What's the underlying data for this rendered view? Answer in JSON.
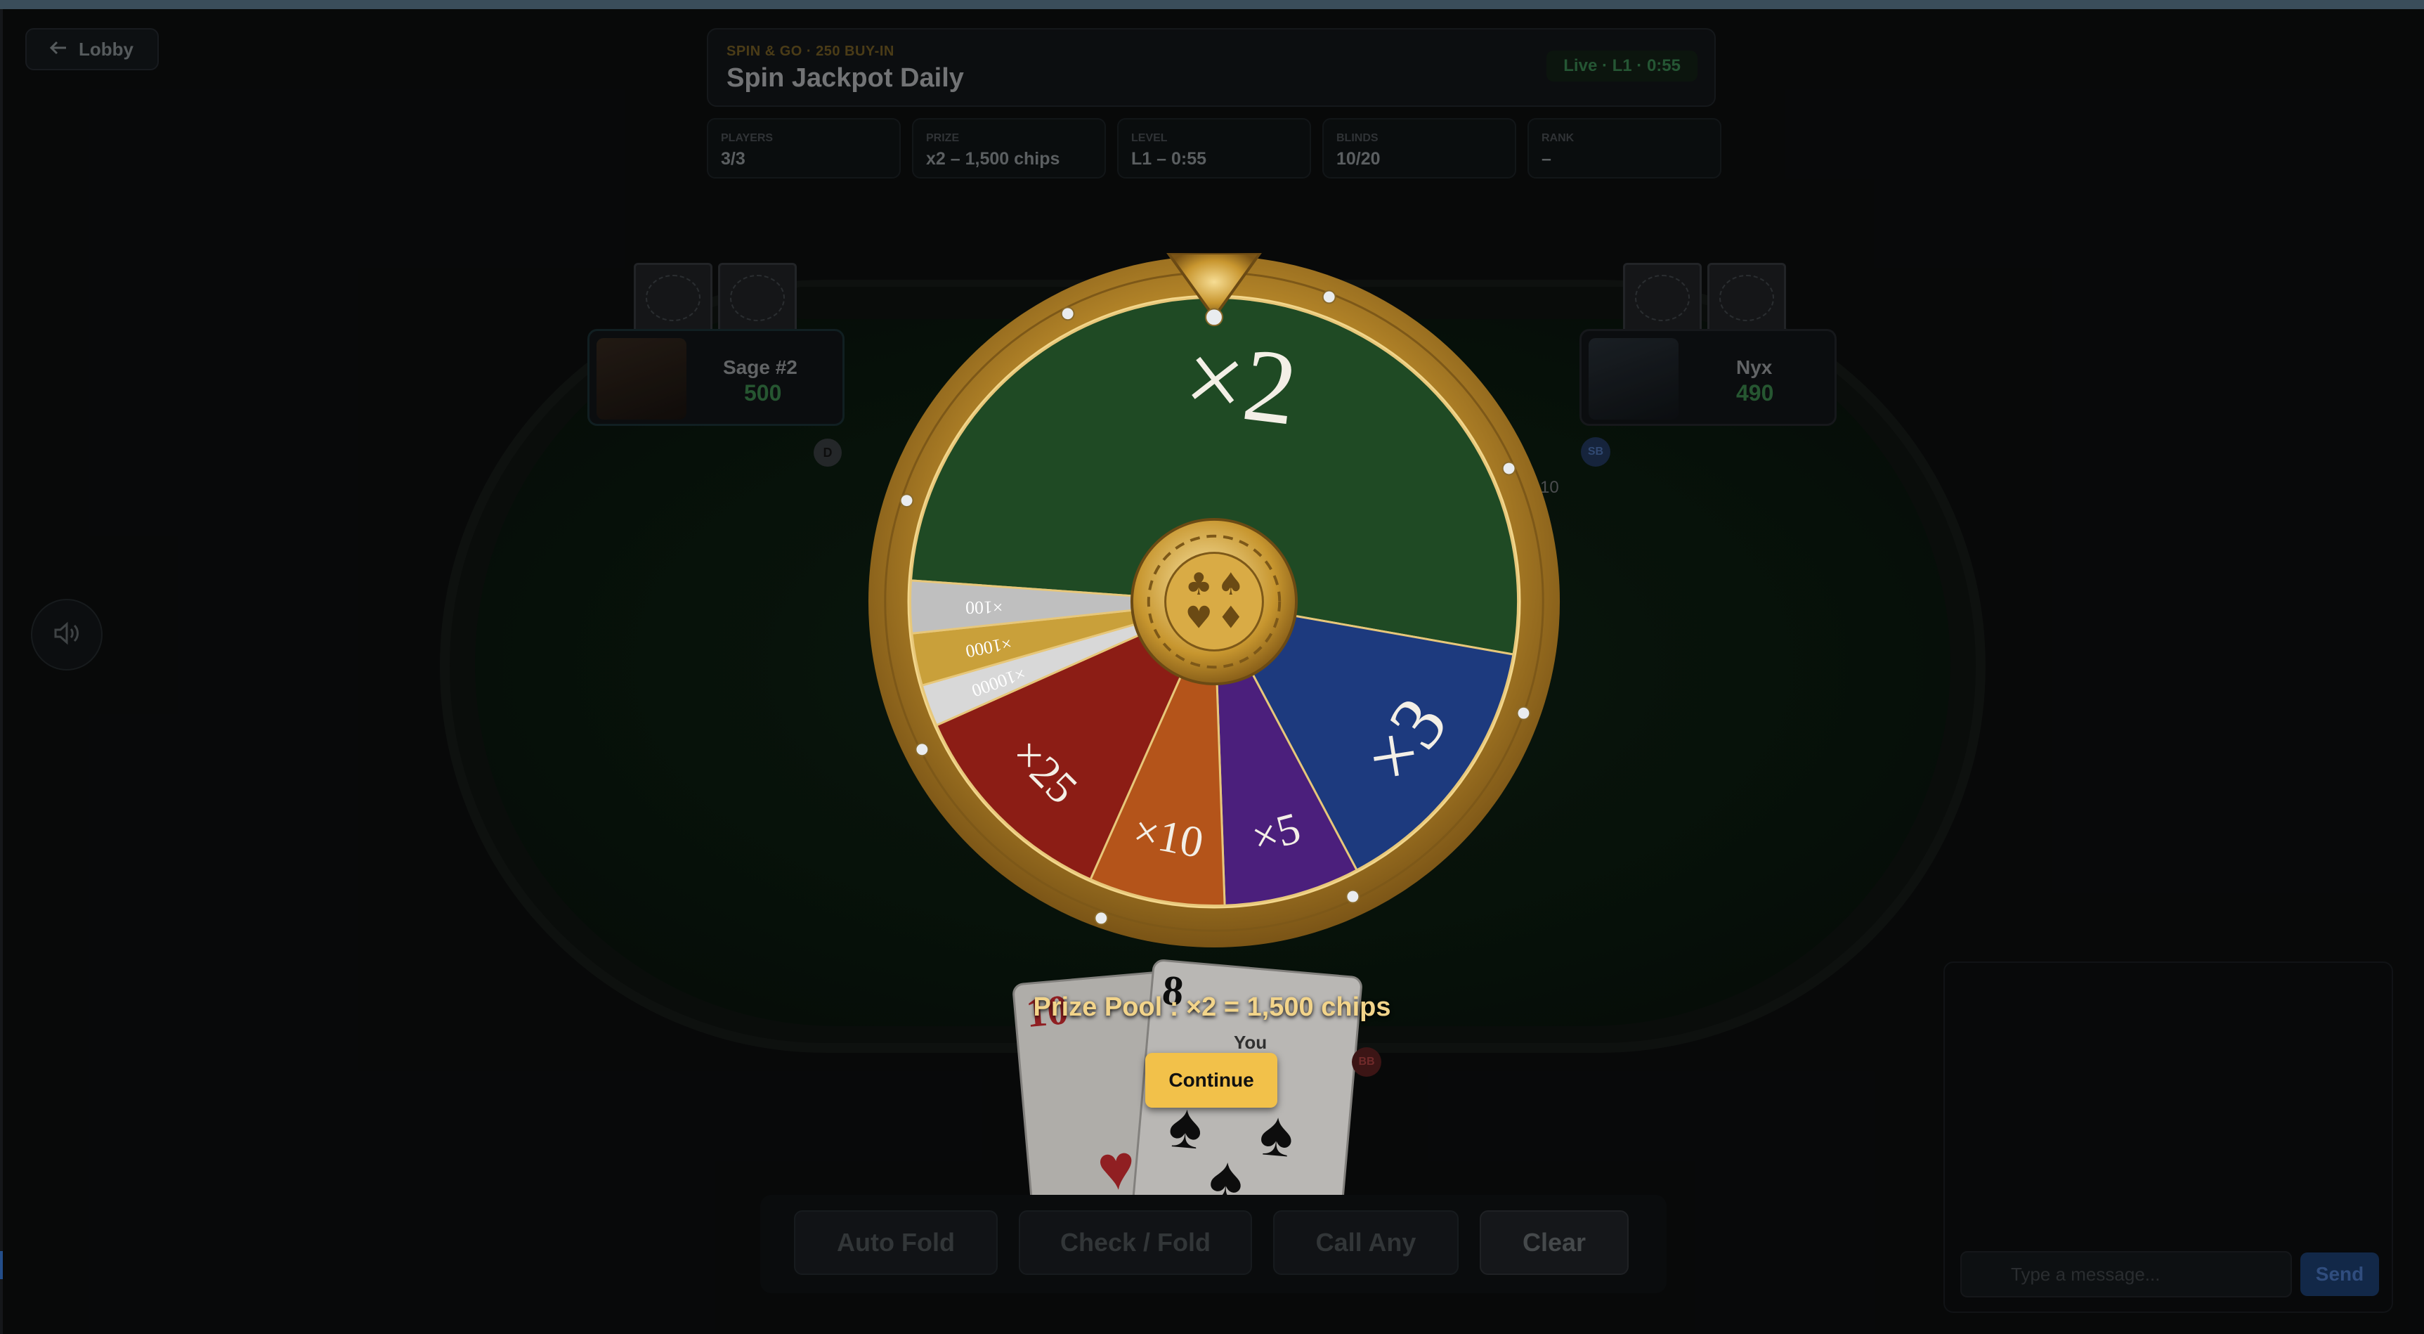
{
  "nav": {
    "back_label": "Lobby"
  },
  "header": {
    "subtitle": "SPIN & GO · 250 BUY-IN",
    "title": "Spin Jackpot Daily",
    "status": "Live · L1 · 0:55"
  },
  "stats": [
    {
      "label": "PLAYERS",
      "value": "3/3"
    },
    {
      "label": "PRIZE",
      "value": "x2 – 1,500 chips"
    },
    {
      "label": "LEVEL",
      "value": "L1 – 0:55"
    },
    {
      "label": "BLINDS",
      "value": "10/20"
    },
    {
      "label": "RANK",
      "value": "–"
    }
  ],
  "seats": {
    "left": {
      "name": "Sage #2",
      "chips": "500",
      "button": "D"
    },
    "right": {
      "name": "Nyx",
      "chips": "490",
      "blind": "SB",
      "bet": "10"
    },
    "hero": {
      "name": "You",
      "blind": "BB"
    }
  },
  "hero_cards": [
    {
      "rank": "10",
      "suit": "♥",
      "color": "#b0262a"
    },
    {
      "rank": "8",
      "suit": "♠",
      "color": "#111111"
    }
  ],
  "wheel": {
    "segments": [
      {
        "label": "×2",
        "color": "#1f4a24"
      },
      {
        "label": "×3",
        "color": "#1d3a7e"
      },
      {
        "label": "×5",
        "color": "#4b1f7c"
      },
      {
        "label": "×10",
        "color": "#b4541a"
      },
      {
        "label": "×25",
        "color": "#8c1d15"
      },
      {
        "label": "×10000",
        "color": "#d8d8d8"
      },
      {
        "label": "×1000",
        "color": "#c9a03a"
      },
      {
        "label": "×100",
        "color": "#bfbfbf"
      }
    ],
    "result_text": "Prize Pool : ×2 = 1,500 chips",
    "continue_label": "Continue"
  },
  "actions": [
    {
      "label": "Auto Fold"
    },
    {
      "label": "Check / Fold"
    },
    {
      "label": "Call Any"
    },
    {
      "label": "Clear"
    }
  ],
  "chat": {
    "placeholder": "Type a message...",
    "send_label": "Send"
  },
  "colors": {
    "accent_gold": "#f2c14a",
    "felt_green": "#0c1f12",
    "send_blue": "#163158"
  }
}
